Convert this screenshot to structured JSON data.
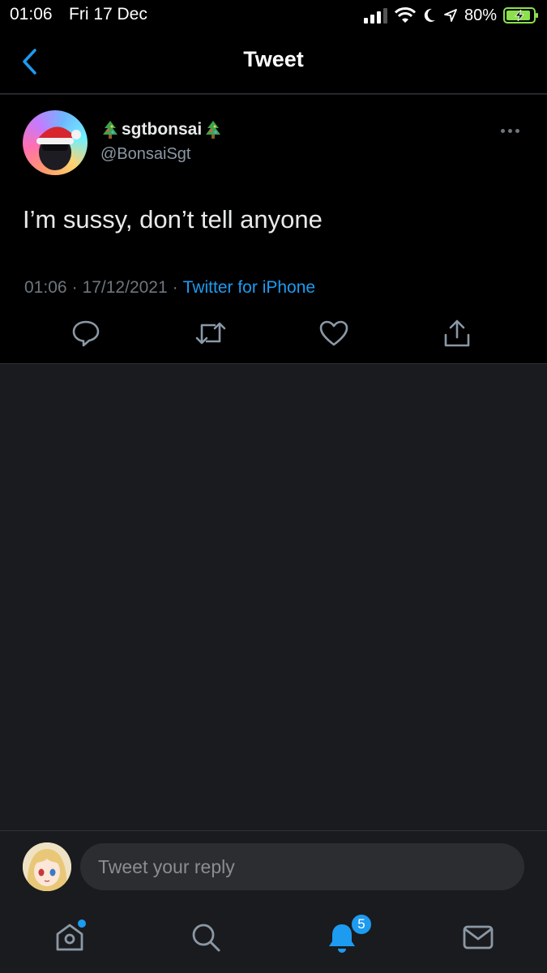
{
  "status_bar": {
    "time": "01:06",
    "date": "Fri 17 Dec",
    "battery_percent": "80%",
    "icons": [
      "cellular-signal-icon",
      "wifi-icon",
      "moon-icon",
      "location-arrow-icon",
      "battery-charging-icon"
    ]
  },
  "header": {
    "title": "Tweet",
    "back_icon": "chevron-left-icon"
  },
  "tweet": {
    "display_name": "sgtbonsai",
    "name_decoration_icon": "christmas-tree-icon",
    "handle": "@BonsaiSgt",
    "text": "I’m sussy, don’t tell anyone",
    "time": "01:06",
    "date": "17/12/2021",
    "separator": "·",
    "source": "Twitter for iPhone",
    "actions": [
      "reply-icon",
      "retweet-icon",
      "like-icon",
      "share-icon"
    ],
    "more_icon": "more-dots-icon"
  },
  "reply": {
    "placeholder": "Tweet your reply"
  },
  "tab_bar": {
    "items": [
      "home-icon",
      "search-icon",
      "notifications-icon",
      "messages-icon"
    ],
    "notifications_count": "5"
  },
  "colors": {
    "accent": "#1d9bf0",
    "background": "#000000",
    "empty_area": "#1a1b1e",
    "muted_text": "#6e767d"
  }
}
